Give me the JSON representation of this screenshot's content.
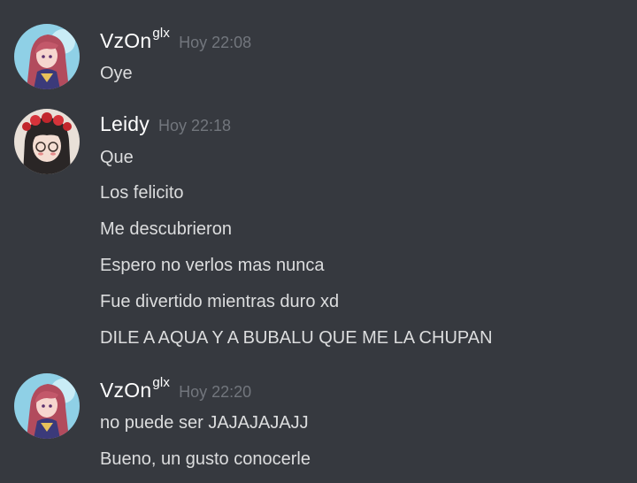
{
  "messages": [
    {
      "username": "VzOn",
      "username_sup": "glx",
      "timestamp": "Hoy 22:08",
      "avatar_icon": "anime-redhair-avatar-icon",
      "lines": [
        "Oye"
      ]
    },
    {
      "username": "Leidy",
      "username_sup": "",
      "timestamp": "Hoy 22:18",
      "avatar_icon": "anime-flower-crown-avatar-icon",
      "lines": [
        "Que",
        "Los felicito",
        "Me descubrieron",
        "Espero no verlos mas nunca",
        "Fue divertido mientras duro xd",
        "DILE A AQUA Y A BUBALU QUE ME LA CHUPAN"
      ]
    },
    {
      "username": "VzOn",
      "username_sup": "glx",
      "timestamp": "Hoy 22:20",
      "avatar_icon": "anime-redhair-avatar-icon",
      "lines": [
        "no puede ser JAJAJAJAJJ",
        "Bueno, un gusto conocerle"
      ]
    }
  ],
  "colors": {
    "background": "#36393f",
    "username": "#ffffff",
    "timestamp": "#72767d",
    "text": "#dcddde"
  }
}
